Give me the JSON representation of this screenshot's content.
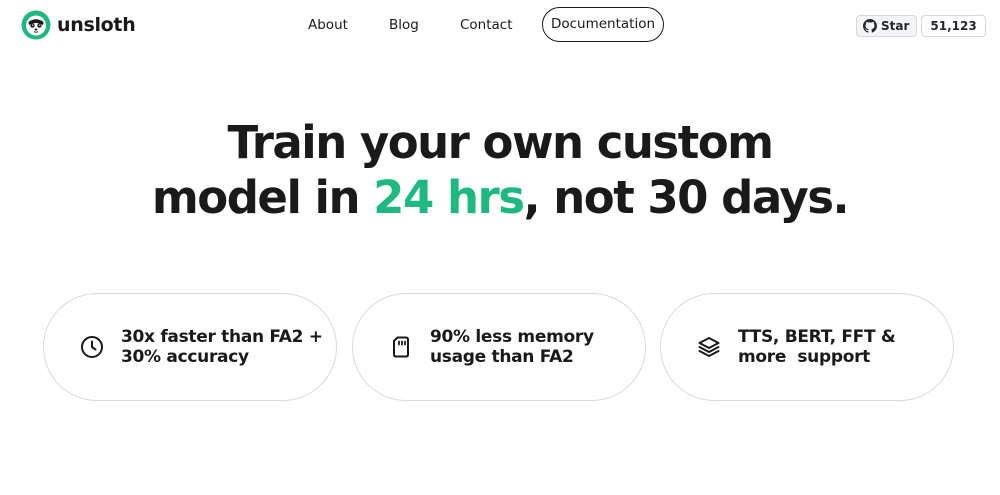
{
  "brand": {
    "name": "unsloth",
    "accent_color": "#1db981",
    "logo_icon": "sloth-logo-icon"
  },
  "nav": {
    "links": [
      {
        "label": "About"
      },
      {
        "label": "Blog"
      },
      {
        "label": "Contact"
      }
    ],
    "docs_button": "Documentation"
  },
  "github": {
    "icon": "github-icon",
    "star_label": "Star",
    "star_count": "51,123"
  },
  "hero": {
    "line1": "Train your own custom",
    "line2_prefix": "model in ",
    "line2_accent": "24 hrs",
    "line2_suffix": ", not 30 days."
  },
  "features": [
    {
      "icon": "clock-icon",
      "line1": "30x faster than FA2 +",
      "line2": "30% accuracy"
    },
    {
      "icon": "memory-card-icon",
      "line1": "90% less memory",
      "line2": "usage than FA2"
    },
    {
      "icon": "layers-icon",
      "line1": "TTS, BERT, FFT &",
      "line2": "more  support"
    }
  ]
}
